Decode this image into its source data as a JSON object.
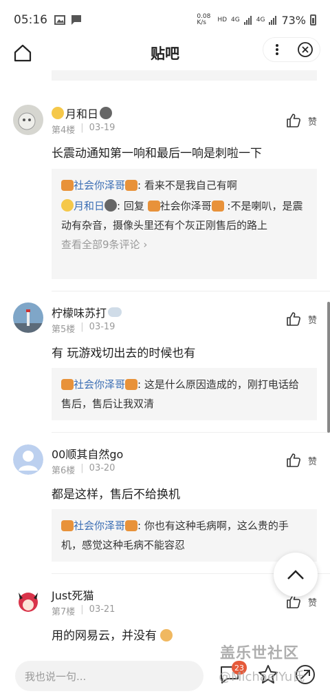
{
  "status_bar": {
    "time": "05:16",
    "net_speed": "0.08 K/s",
    "hd": "HD",
    "sig1": "4G",
    "sig2": "4G",
    "battery": "73%"
  },
  "header": {
    "title": "贴吧"
  },
  "posts": [
    {
      "username": "月和日",
      "floor": "第4楼",
      "date": "03-19",
      "like_label": "赞",
      "content": "长震动通知第一响和最后一响是刺啦一下",
      "replies": [
        {
          "user": "社会你泽哥",
          "sep": ": ",
          "text": "看来不是我自己有啊"
        },
        {
          "user": "月和日",
          "mid": ": 回复 ",
          "target": "社会你泽哥",
          "sep": " :",
          "text": "不是喇叭，是震动有杂音，摄像头里还有个灰正刚售后的路上"
        }
      ],
      "view_all": "查看全部9条评论"
    },
    {
      "username": "柠檬味苏打",
      "floor": "第5楼",
      "date": "03-19",
      "like_label": "赞",
      "content": "有 玩游戏切出去的时候也有",
      "replies": [
        {
          "user": "社会你泽哥",
          "sep": ": ",
          "text": "这是什么原因造成的，刚打电话给售后，售后让我双清"
        }
      ]
    },
    {
      "username": "00顺其自然go",
      "floor": "第6楼",
      "date": "03-20",
      "like_label": "赞",
      "content": "都是这样，售后不给换机",
      "replies": [
        {
          "user": "社会你泽哥",
          "sep": ": ",
          "text": "你也有这种毛病啊，这么贵的手机，感觉这种毛病不能容忍"
        }
      ]
    },
    {
      "username": "Just死猫",
      "floor": "第7楼",
      "date": "03-21",
      "like_label": "赞",
      "content": "用的网易云，并没有"
    }
  ],
  "bottom_bar": {
    "input_placeholder": "我也说一句...",
    "comment_count": "23"
  },
  "watermark": {
    "line1": "盖乐世社区",
    "line2": "@MichaelYu氏"
  }
}
